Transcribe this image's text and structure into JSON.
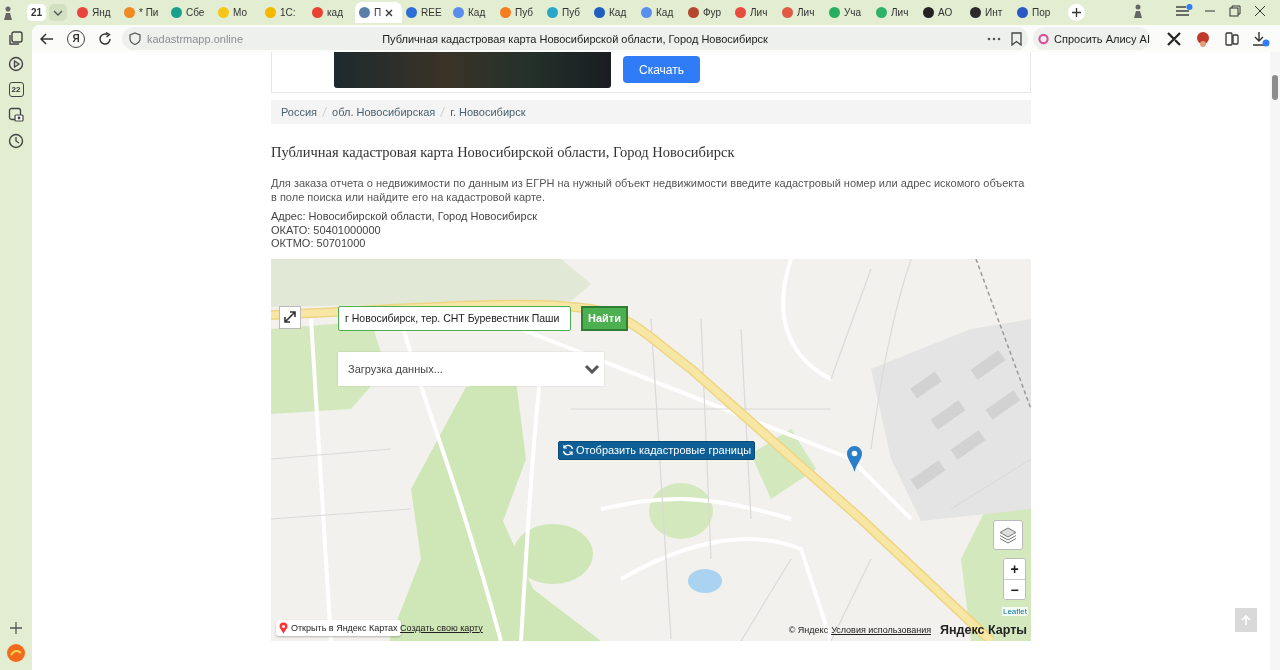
{
  "browser": {
    "tab_count": "21",
    "tabs": [
      {
        "title": "Янд",
        "color": "#e8453c",
        "selected": false
      },
      {
        "title": "* Пи",
        "color": "#f08a24",
        "selected": false
      },
      {
        "title": "Сбе",
        "color": "#1a9f8c",
        "selected": false
      },
      {
        "title": "Мо",
        "color": "#f5c518",
        "selected": false
      },
      {
        "title": "1С:",
        "color": "#f5b800",
        "selected": false
      },
      {
        "title": "кад",
        "color": "#e94235",
        "selected": false
      },
      {
        "title": "П",
        "color": "#5b7fa6",
        "selected": true
      },
      {
        "title": "REE",
        "color": "#2d6fd6",
        "selected": false
      },
      {
        "title": "Кад",
        "color": "#5b8def",
        "selected": false
      },
      {
        "title": "Пуб",
        "color": "#f57c1f",
        "selected": false
      },
      {
        "title": "Пуб",
        "color": "#2aa6c9",
        "selected": false
      },
      {
        "title": "Кад",
        "color": "#1f5fbf",
        "selected": false
      },
      {
        "title": "Кад",
        "color": "#5b8def",
        "selected": false
      },
      {
        "title": "Фур",
        "color": "#b5472f",
        "selected": false
      },
      {
        "title": "Лич",
        "color": "#e74c3c",
        "selected": false
      },
      {
        "title": "Лич",
        "color": "#e05a47",
        "selected": false
      },
      {
        "title": "Уча",
        "color": "#27ae60",
        "selected": false
      },
      {
        "title": "Лич",
        "color": "#2fb36b",
        "selected": false
      },
      {
        "title": "АО",
        "color": "#222222",
        "selected": false
      },
      {
        "title": "Инт",
        "color": "#2b2b2b",
        "selected": false
      },
      {
        "title": "Пор",
        "color": "#2b59c3",
        "selected": false
      }
    ],
    "home_logo": "Я",
    "address": {
      "url": "kadastrmapp.online",
      "title": "Публичная кадастровая карта Новосибирской области, Город Новосибирск"
    },
    "ask_button": "Спросить Алису AI",
    "sidebar": {
      "calendar_day": "22"
    }
  },
  "ad": {
    "button": "Скачать"
  },
  "breadcrumbs": [
    "Россия",
    "обл. Новосибирская",
    "г. Новосибирск"
  ],
  "heading": "Публичная кадастровая карта Новосибирской области, Город Новосибирск",
  "intro": "Для заказа отчета о недвижимости по данным из ЕГРН на нужный объект недвижимости введите кадастровый номер или адрес искомого объекта в поле поиска или найдите его на кадастровой карте.",
  "details": [
    "Адрес: Новосибирской области, Город Новосибирск",
    "ОКАТО: 50401000000",
    "ОКТМО: 50701000"
  ],
  "map": {
    "search": {
      "value": "г Новосибирск, тер. СНТ Буревестник Паши"
    },
    "search_button": "Найти",
    "dropdown": {
      "text": "Загрузка данных..."
    },
    "boundaries_button": "Отобразить кадастровые границы",
    "zoom": [
      "+",
      "−"
    ],
    "attribution": "Leaflet",
    "open_link": "Открыть в Яндекс Картах",
    "create_link": "Создать свою карту",
    "copyright": "© Яндекс",
    "terms_link": "Условия использования",
    "logo": "Яндекс Карты"
  }
}
